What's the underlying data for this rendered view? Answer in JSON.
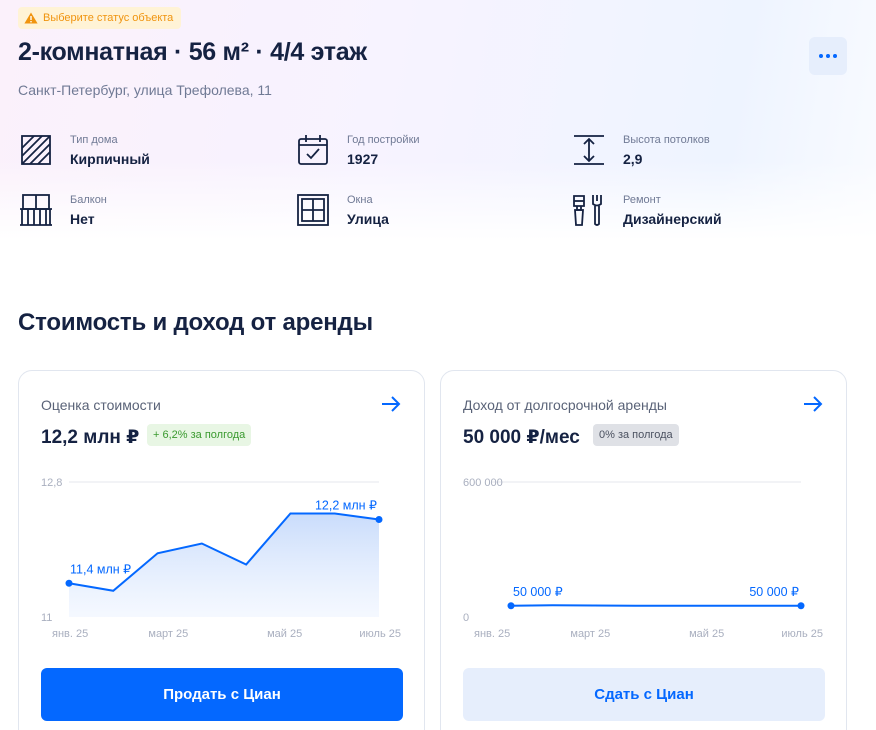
{
  "status_badge": {
    "text": "Выберите статус объекта",
    "color": "#f0940f"
  },
  "title": "2-комнатная · 56 м² · 4/4 этаж",
  "address": "Санкт-Петербург, улица Трефолева, 11",
  "more_icon": "more-dots-icon",
  "features": [
    {
      "label": "Тип дома",
      "value": "Кирпичный",
      "icon": "brick-wall-icon"
    },
    {
      "label": "Год постройки",
      "value": "1927",
      "icon": "calendar-icon"
    },
    {
      "label": "Высота потолков",
      "value": "2,9",
      "icon": "ceiling-height-icon"
    },
    {
      "label": "Балкон",
      "value": "Нет",
      "icon": "balcony-icon"
    },
    {
      "label": "Окна",
      "value": "Улица",
      "icon": "window-icon"
    },
    {
      "label": "Ремонт",
      "value": "Дизайнерский",
      "icon": "renovation-tools-icon"
    }
  ],
  "section_title": "Стоимость и доход от аренды",
  "cards": {
    "valuation": {
      "title": "Оценка стоимости",
      "price": "12,2 млн ₽",
      "chip": "+ 6,2% за полгода",
      "button": "Продать с Циан"
    },
    "rent": {
      "title": "Доход от долгосрочной аренды",
      "price": "50 000 ₽/мес",
      "chip": "0% за полгода",
      "button": "Сдать с Циан"
    }
  },
  "colors": {
    "accent": "#0468ff",
    "text": "#152242",
    "muted": "#707a95",
    "positive": "#3a9a2f"
  },
  "chart_data": [
    {
      "type": "area",
      "x_ticks": [
        "янв. 25",
        "март 25",
        "май 25",
        "июль 25"
      ],
      "y_ticks": [
        "11",
        "12,8"
      ],
      "ylim": [
        11,
        12.8
      ],
      "values": [
        11.45,
        11.35,
        11.85,
        11.98,
        11.7,
        12.38,
        12.38,
        12.3
      ],
      "annotations": [
        {
          "index": 0,
          "text": "11,4 млн ₽"
        },
        {
          "index": 7,
          "text": "12,2 млн ₽"
        }
      ]
    },
    {
      "type": "line",
      "x_ticks": [
        "янв. 25",
        "март 25",
        "май 25",
        "июль 25"
      ],
      "y_ticks": [
        "0",
        "600 000"
      ],
      "ylim": [
        0,
        600000
      ],
      "values": [
        50000,
        52000,
        51000,
        50000,
        50000,
        50000,
        50000,
        50000
      ],
      "annotations": [
        {
          "index": 0,
          "text": "50 000 ₽"
        },
        {
          "index": 7,
          "text": "50 000 ₽"
        }
      ]
    }
  ]
}
